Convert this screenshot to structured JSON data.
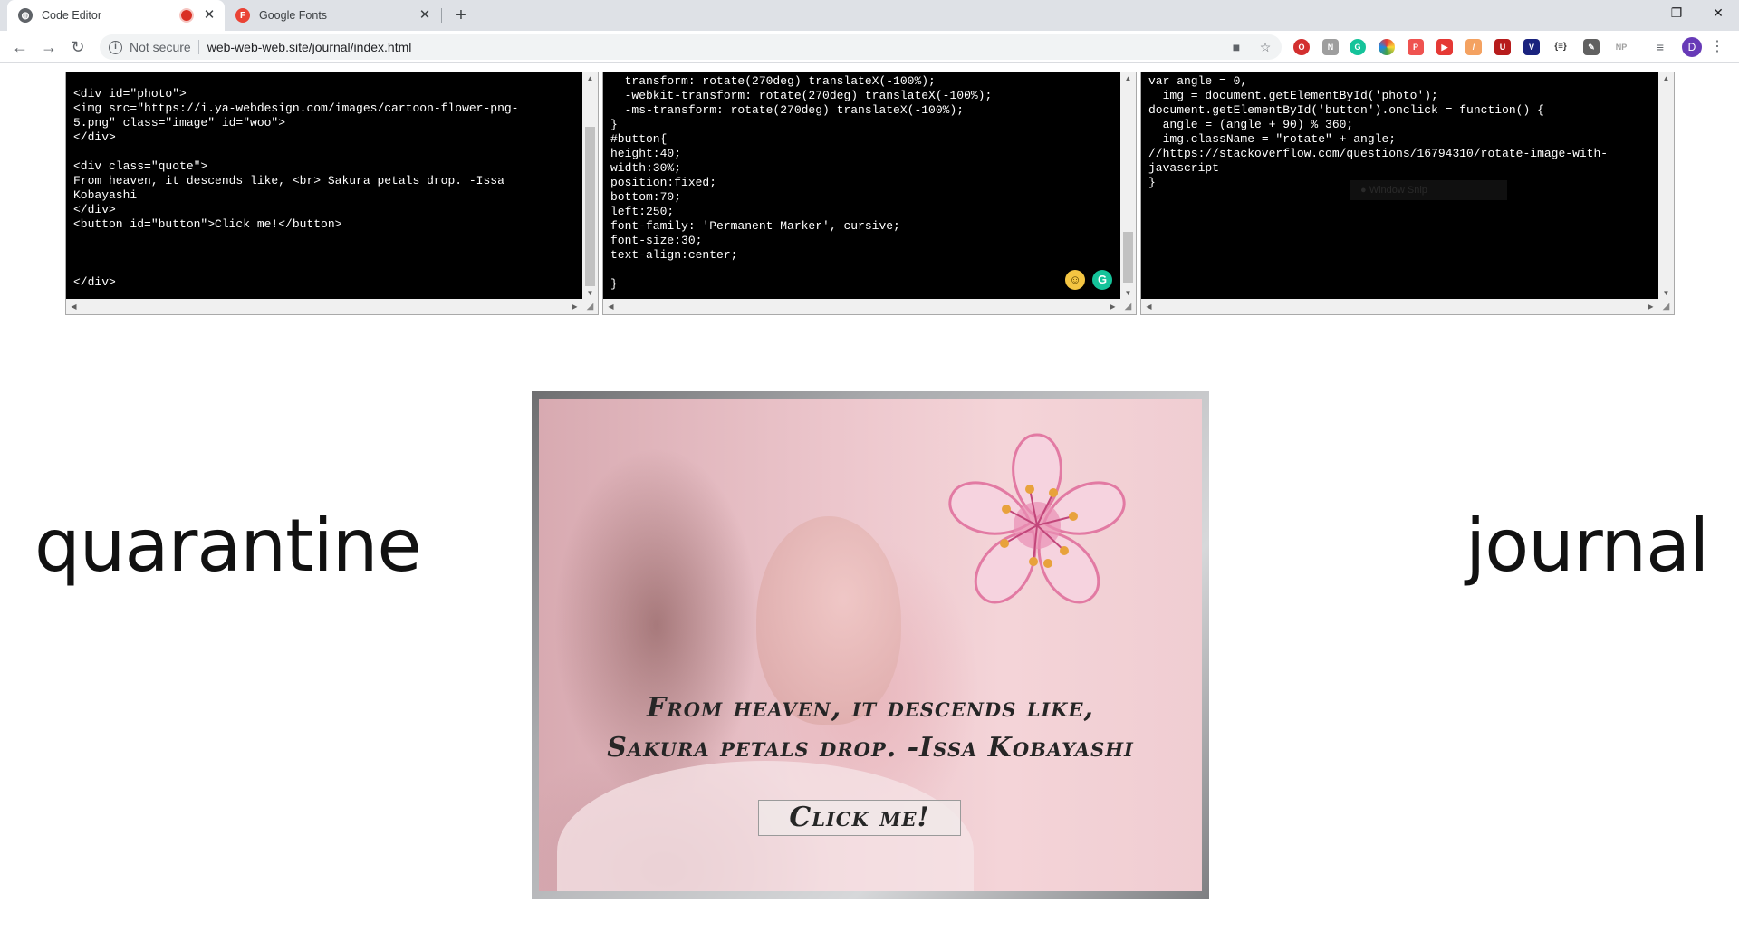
{
  "browser": {
    "tabs": [
      {
        "title": "Code Editor",
        "favicon": "globe-icon",
        "recording": true
      },
      {
        "title": "Google Fonts",
        "favicon": "F"
      }
    ],
    "new_tab": "+",
    "window_controls": {
      "minimize": "–",
      "restore": "❐",
      "close": "✕"
    },
    "security_label": "Not secure",
    "url": "web-web-web.site/journal/index.html",
    "profile_initial": "D",
    "extensions": [
      "opera-icon",
      "notion-icon",
      "grammarly-icon",
      "color-wheel-icon",
      "pdf-icon",
      "youtube-icon",
      "brush-icon",
      "ublock-icon",
      "vue-devtools-icon",
      "json-icon",
      "dropper-icon",
      "np-icon",
      "reading-list-icon"
    ]
  },
  "editor": {
    "html_code": "<div id=\"photo\">\n<img src=\"https://i.ya-webdesign.com/images/cartoon-flower-png-\n5.png\" class=\"image\" id=\"woo\">\n</div>\n\n<div class=\"quote\">\nFrom heaven, it descends like, <br> Sakura petals drop. -Issa\nKobayashi\n</div>\n<button id=\"button\">Click me!</button>\n\n\n\n</div>",
    "css_code": "  transform: rotate(270deg) translateX(-100%);\n  -webkit-transform: rotate(270deg) translateX(-100%);\n  -ms-transform: rotate(270deg) translateX(-100%);\n}\n#button{\nheight:40;\nwidth:30%;\nposition:fixed;\nbottom:70;\nleft:250;\nfont-family: 'Permanent Marker', cursive;\nfont-size:30;\ntext-align:center;\n\n}",
    "js_code": "var angle = 0,\n  img = document.getElementById('photo');\ndocument.getElementById('button').onclick = function() {\n  angle = (angle + 90) % 360;\n  img.className = \"rotate\" + angle;\n//https://stackoverflow.com/questions/16794310/rotate-image-with-\njavascript\n}",
    "window_snip_label": "Window Snip"
  },
  "page": {
    "left_word": "quarantine",
    "right_word": "journal",
    "quote_line1": "From heaven, it descends like,",
    "quote_line2": "Sakura petals drop. -Issa Kobayashi",
    "button_label": "Click me!"
  },
  "colors": {
    "tab_bar": "#dee1e6",
    "code_bg": "#000000",
    "photo_tint": "#ecc6cc",
    "flower_petal": "#f6d3df",
    "flower_outline": "#e27aa3",
    "flower_stamen": "#e8a23c"
  }
}
